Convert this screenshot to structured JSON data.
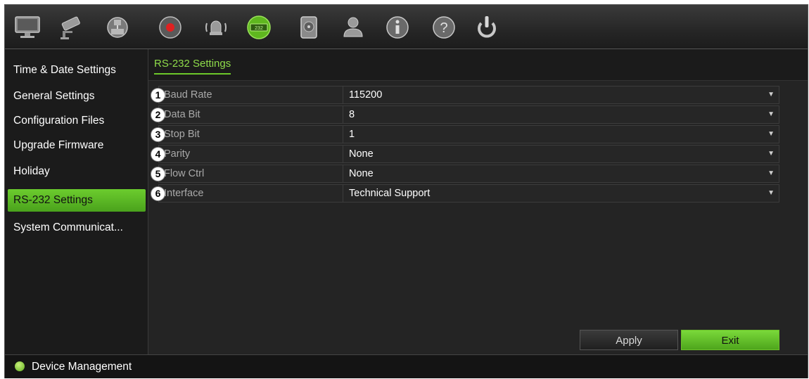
{
  "toolbar": {
    "icons": [
      {
        "name": "monitor-icon"
      },
      {
        "name": "camera-icon"
      },
      {
        "name": "network-icon"
      },
      {
        "name": "record-icon"
      },
      {
        "name": "alarm-icon"
      },
      {
        "name": "device-management-icon",
        "active": true
      },
      {
        "name": "storage-icon"
      },
      {
        "name": "user-icon"
      },
      {
        "name": "info-icon"
      },
      {
        "name": "help-icon"
      },
      {
        "name": "power-icon"
      }
    ],
    "accent_color": "#6dc82a"
  },
  "sidebar": {
    "items": [
      {
        "label": "Time & Date Settings"
      },
      {
        "label": "General Settings"
      },
      {
        "label": "Configuration Files"
      },
      {
        "label": "Upgrade Firmware"
      },
      {
        "label": "Holiday"
      },
      {
        "label": "RS-232 Settings",
        "active": true
      },
      {
        "label": "System Communicat..."
      }
    ]
  },
  "main": {
    "tab": "RS-232 Settings",
    "settings": [
      {
        "number": "1",
        "label": "Baud Rate",
        "value": "115200"
      },
      {
        "number": "2",
        "label": "Data Bit",
        "value": "8"
      },
      {
        "number": "3",
        "label": "Stop Bit",
        "value": "1"
      },
      {
        "number": "4",
        "label": "Parity",
        "value": "None"
      },
      {
        "number": "5",
        "label": "Flow Ctrl",
        "value": "None"
      },
      {
        "number": "6",
        "label": "Interface",
        "value": "Technical Support"
      }
    ],
    "apply_label": "Apply",
    "exit_label": "Exit"
  },
  "status": {
    "text": "Device Management"
  }
}
